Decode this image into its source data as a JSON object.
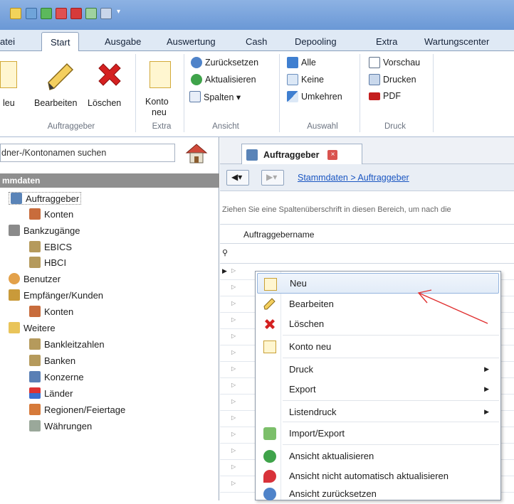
{
  "quick_access": {
    "icons": [
      "ribbon-doc-icon",
      "save-icon",
      "export-green-icon",
      "delete-red-icon",
      "red-bar-icon",
      "table-icon",
      "dropdown-settings-icon"
    ]
  },
  "tabs": [
    "atei",
    "Start",
    "Ausgabe",
    "Auswertung",
    "Cash",
    "Depooling",
    "Extra",
    "Wartungscenter"
  ],
  "ribbon": {
    "auftraggeber": {
      "neu": "leu",
      "bearbeiten": "Bearbeiten",
      "loeschen": "Löschen",
      "group": "Auftraggeber"
    },
    "extra": {
      "konto_neu_1": "Konto",
      "konto_neu_2": "neu",
      "group": "Extra"
    },
    "ansicht": {
      "zuruecksetzen": "Zurücksetzen",
      "aktualisieren": "Aktualisieren",
      "spalten": "Spalten ▾",
      "group": "Ansicht"
    },
    "auswahl": {
      "alle": "Alle",
      "keine": "Keine",
      "umkehren": "Umkehren",
      "group": "Auswahl"
    },
    "druck": {
      "vorschau": "Vorschau",
      "drucken": "Drucken",
      "pdf": "PDF",
      "group": "Druck"
    }
  },
  "left": {
    "search_placeholder": "dner-/Kontonamen suchen",
    "header": "mmdaten",
    "items": [
      {
        "label": "Auftraggeber",
        "icon": "auftraggeber-icon"
      },
      {
        "label": "Konten",
        "icon": "konten-icon"
      },
      {
        "label": "Bankzugänge",
        "icon": "bank-access-icon"
      },
      {
        "label": "EBICS",
        "icon": "bank-icon"
      },
      {
        "label": "HBCI",
        "icon": "bank-icon"
      },
      {
        "label": "Benutzer",
        "icon": "user-icon"
      },
      {
        "label": "Empfänger/Kunden",
        "icon": "recipient-icon"
      },
      {
        "label": "Konten",
        "icon": "konten-icon"
      },
      {
        "label": "Weitere",
        "icon": "folder-icon"
      },
      {
        "label": "Bankleitzahlen",
        "icon": "bank-icon"
      },
      {
        "label": "Banken",
        "icon": "bank-icon"
      },
      {
        "label": "Konzerne",
        "icon": "building-icon"
      },
      {
        "label": "Länder",
        "icon": "flag-icon"
      },
      {
        "label": "Regionen/Feiertage",
        "icon": "calendar-icon"
      },
      {
        "label": "Währungen",
        "icon": "currency-icon"
      }
    ]
  },
  "right": {
    "doc_tab": "Auftraggeber",
    "breadcrumb": "Stammdaten > Auftraggeber",
    "group_hint": "Ziehen Sie eine Spaltenüberschrift in diesen Bereich, um nach die",
    "column_header": "Auftraggebername"
  },
  "context_menu": [
    {
      "label": "Neu",
      "icon": "new-doc-icon",
      "highlight": true
    },
    {
      "label": "Bearbeiten",
      "icon": "pencil-icon"
    },
    {
      "label": "Löschen",
      "icon": "red-x-icon"
    },
    {
      "label": "Konto neu",
      "icon": "new-doc-icon"
    },
    {
      "label": "Druck",
      "submenu": true
    },
    {
      "label": "Export",
      "submenu": true
    },
    {
      "label": "Listendruck",
      "submenu": true
    },
    {
      "label": "Import/Export",
      "icon": "import-export-icon"
    },
    {
      "label": "Ansicht aktualisieren",
      "icon": "refresh-icon"
    },
    {
      "label": "Ansicht nicht automatisch aktualisieren",
      "icon": "pin-icon"
    },
    {
      "label": "Ansicht zurücksetzen",
      "icon": "reset-icon"
    }
  ],
  "colors": {
    "accent": "#6a98d6",
    "annotation_arrow": "#e03030"
  }
}
